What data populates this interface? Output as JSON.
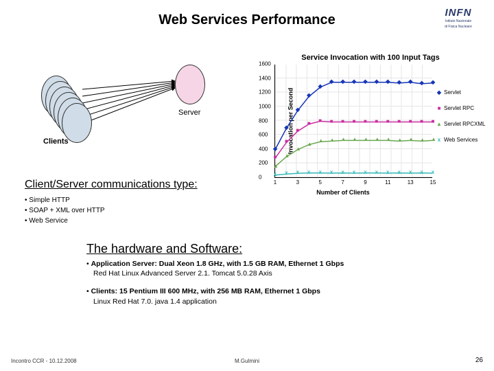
{
  "title": "Web Services Performance",
  "logo": {
    "name": "INFN",
    "sub1": "Istituto Nazionale",
    "sub2": "di Fisica Nucleare"
  },
  "diagram": {
    "server_label": "Server",
    "clients_label": "Clients"
  },
  "comm": {
    "heading": "Client/Server communications type:",
    "items": [
      "Simple HTTP",
      "SOAP + XML over HTTP",
      "Web Service"
    ]
  },
  "hw": {
    "heading": "The hardware and Software:",
    "app_server_label": "Application Server: Dual Xeon 1.8 GHz, with 1.5 GB RAM, Ethernet 1 Gbps",
    "app_server_detail": "Red Hat Linux Advanced Server 2.1. Tomcat 5.0.28 Axis",
    "clients_label": "Clients: 15 Pentium III 600 MHz, with 256 MB RAM, Ethernet 1 Gbps",
    "clients_detail": "Linux Red Hat 7.0. java 1.4 application"
  },
  "footer": {
    "left": "Incontro CCR - 10.12.2008",
    "center": "M.Gulmini",
    "right": "26"
  },
  "chart_data": {
    "type": "line",
    "title": "Service Invocation with 100 Input Tags",
    "xlabel": "Number of Clients",
    "ylabel": "Invocation per Second",
    "x": [
      1,
      2,
      3,
      4,
      5,
      6,
      7,
      8,
      9,
      10,
      11,
      12,
      13,
      14,
      15
    ],
    "ylim": [
      0,
      1600
    ],
    "yticks": [
      0,
      200,
      400,
      600,
      800,
      1000,
      1200,
      1400,
      1600
    ],
    "series": [
      {
        "name": "Servlet",
        "marker": "◆",
        "color": "#1535b6",
        "values": [
          400,
          700,
          950,
          1150,
          1280,
          1350,
          1350,
          1350,
          1350,
          1350,
          1350,
          1340,
          1350,
          1330,
          1340
        ]
      },
      {
        "name": "Servlet RPC",
        "marker": "■",
        "color": "#c82ea0",
        "values": [
          280,
          500,
          660,
          760,
          800,
          790,
          790,
          790,
          790,
          790,
          790,
          790,
          790,
          790,
          790
        ]
      },
      {
        "name": "Servlet RPCXML",
        "marker": "▲",
        "color": "#6aa84f",
        "values": [
          160,
          300,
          400,
          470,
          510,
          520,
          530,
          530,
          530,
          530,
          530,
          520,
          530,
          520,
          530
        ]
      },
      {
        "name": "Web Services",
        "marker": "x",
        "color": "#35b8b8",
        "values": [
          40,
          55,
          65,
          70,
          70,
          68,
          70,
          68,
          70,
          70,
          68,
          70,
          68,
          70,
          68
        ]
      }
    ]
  }
}
